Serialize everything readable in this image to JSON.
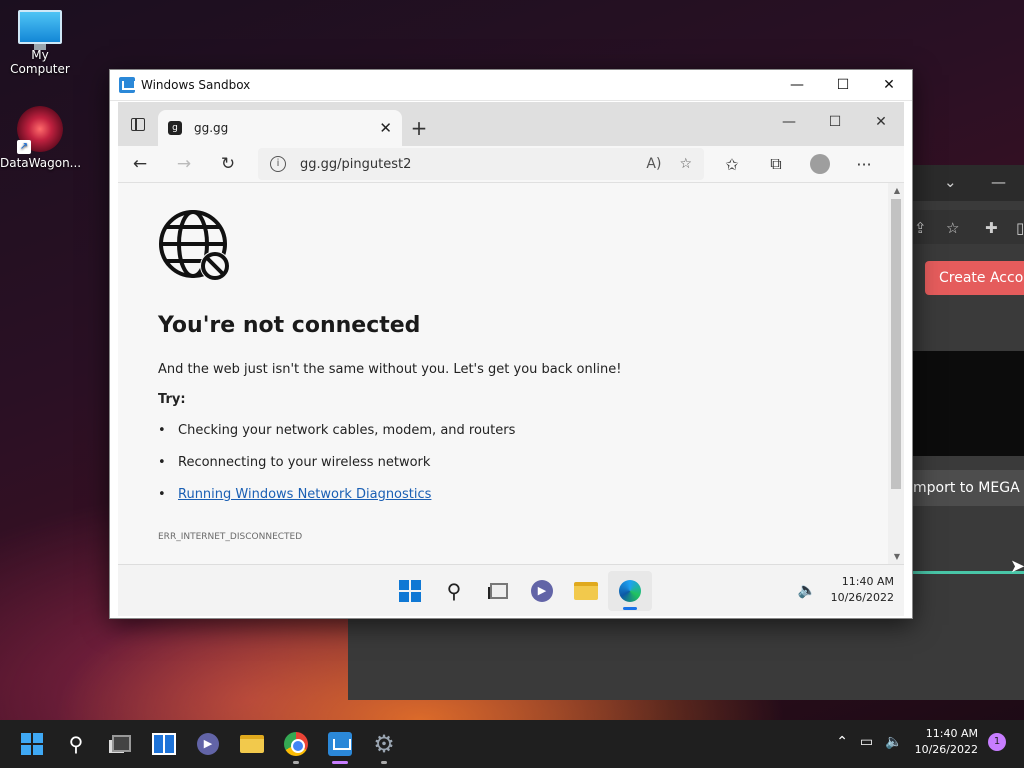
{
  "desktop": {
    "icons": [
      {
        "label": "My Computer"
      },
      {
        "label": "DataWagon..."
      }
    ]
  },
  "background_window": {
    "create_account_label": "Create Accou",
    "import_label": "mport to MEGA"
  },
  "sandbox": {
    "title": "Windows Sandbox",
    "controls": {
      "minimize": "—",
      "maximize": "☐",
      "close": "✕"
    }
  },
  "browser": {
    "tab": {
      "title": "gg.gg",
      "close": "✕"
    },
    "new_tab": "+",
    "window_controls": {
      "minimize": "—",
      "maximize": "☐",
      "close": "✕"
    },
    "nav": {
      "back": "←",
      "forward": "→",
      "refresh": "↻"
    },
    "address": {
      "url": "gg.gg/pingutest2",
      "info": "i"
    },
    "toolbar_icons": [
      "read-aloud-icon",
      "add-favorite-icon",
      "favorites-icon",
      "collections-icon",
      "profile-icon",
      "more-icon"
    ]
  },
  "error_page": {
    "title": "You're not connected",
    "description": "And the web just isn't the same without you. Let's get you back online!",
    "try_label": "Try:",
    "suggestions": [
      "Checking your network cables, modem, and routers",
      "Reconnecting to your wireless network",
      "Running Windows Network Diagnostics"
    ],
    "error_code": "ERR_INTERNET_DISCONNECTED"
  },
  "sandbox_taskbar": {
    "time": "11:40 AM",
    "date": "10/26/2022",
    "icons": [
      "start-icon",
      "search-icon",
      "task-view-icon",
      "chat-icon",
      "file-explorer-icon",
      "edge-icon"
    ]
  },
  "taskbar": {
    "time": "11:40 AM",
    "date": "10/26/2022",
    "notification_count": "1",
    "icons": [
      "start-icon",
      "search-icon",
      "task-view-icon",
      "widgets-icon",
      "chat-icon",
      "file-explorer-icon",
      "chrome-icon",
      "windows-sandbox-icon",
      "settings-icon"
    ]
  }
}
